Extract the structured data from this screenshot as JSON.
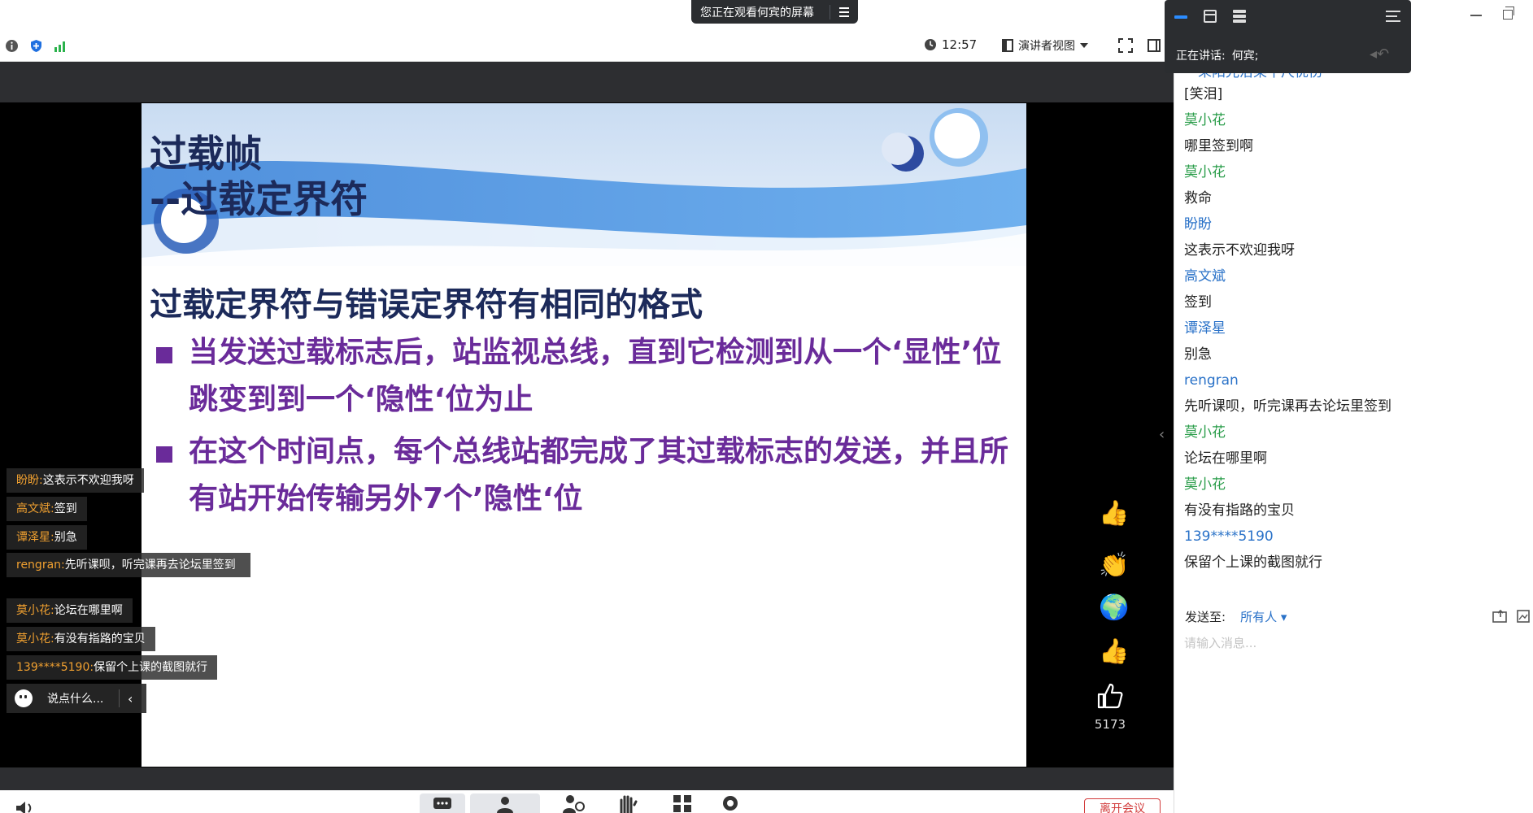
{
  "banner": {
    "sharing_text": "您正在观看何宾的屏幕"
  },
  "toolbar": {
    "time": "12:57",
    "view_mode": "演讲者视图"
  },
  "speaker_widget": {
    "label": "正在讲话:",
    "name": "何宾;"
  },
  "slide": {
    "title_line1": "过载帧",
    "title_line2": "--过载定界符",
    "subtitle": "过载定界符与错误定界符有相同的格式",
    "bullets": [
      "当发送过载标志后，站监视总线，直到它检测到从一个‘显性’位跳变到到一个‘隐性‘位为止",
      "在这个时间点，每个总线站都完成了其过载标志的发送，并且所有站开始传输另外7个’隐性‘位"
    ],
    "colors": {
      "title": "#1c2a5a",
      "bullet": "#6a2b9a",
      "banner": "#5b9be0"
    }
  },
  "reactions": {
    "like_count": "5173"
  },
  "overlay_chat": {
    "items": [
      {
        "name": "盼盼:",
        "text": "这表示不欢迎我呀"
      },
      {
        "name": "高文斌:",
        "text": "签到"
      },
      {
        "name": "谭泽星:",
        "text": "别急"
      },
      {
        "name": "rengran:",
        "text": "先听课呗，听完课再去论坛里签到"
      },
      {
        "name": "莫小花:",
        "text": "论坛在哪里啊"
      },
      {
        "name": "莫小花:",
        "text": "有没有指路的宝贝"
      },
      {
        "name": "139****5190:",
        "text": "保留个上课的截图就行"
      }
    ],
    "input_placeholder": "说点什么..."
  },
  "chat": {
    "partial_top": "一朵阳光洁染午尺优伤",
    "messages": [
      {
        "kind": "text",
        "text": "[笑泪]"
      },
      {
        "kind": "name",
        "color": "green",
        "text": "莫小花"
      },
      {
        "kind": "text",
        "text": "哪里签到啊"
      },
      {
        "kind": "name",
        "color": "green",
        "text": "莫小花"
      },
      {
        "kind": "text",
        "text": "救命"
      },
      {
        "kind": "name",
        "color": "blue",
        "text": "盼盼"
      },
      {
        "kind": "text",
        "text": "这表示不欢迎我呀"
      },
      {
        "kind": "name",
        "color": "blue",
        "text": "高文斌"
      },
      {
        "kind": "text",
        "text": "签到"
      },
      {
        "kind": "name",
        "color": "blue",
        "text": "谭泽星"
      },
      {
        "kind": "text",
        "text": "别急"
      },
      {
        "kind": "name",
        "color": "blue",
        "text": "rengran"
      },
      {
        "kind": "text",
        "text": "先听课呗，听完课再去论坛里签到"
      },
      {
        "kind": "name",
        "color": "green",
        "text": "莫小花"
      },
      {
        "kind": "text",
        "text": "论坛在哪里啊"
      },
      {
        "kind": "name",
        "color": "green",
        "text": "莫小花"
      },
      {
        "kind": "text",
        "text": "有没有指路的宝贝"
      },
      {
        "kind": "name",
        "color": "blue",
        "text": "139****5190"
      },
      {
        "kind": "text",
        "text": "保留个上课的截图就行"
      }
    ],
    "send_to_label": "发送至:",
    "send_to_target": "所有人",
    "input_placeholder": "请输入消息..."
  },
  "bottom": {
    "leave_label": "离开会议"
  }
}
